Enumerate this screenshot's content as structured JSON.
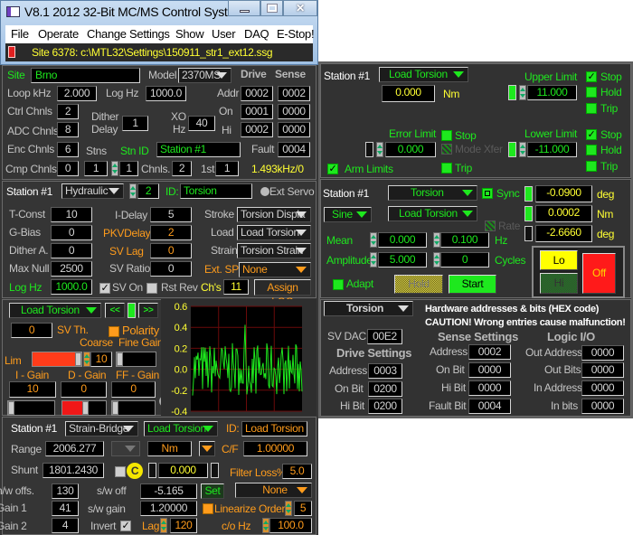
{
  "window": {
    "title": "V8.1 2012 32-Bit MC/MS Control System",
    "menu": [
      "File",
      "Operate",
      "Change Settings",
      "Show",
      "User",
      "DAQ",
      "E-Stop!"
    ],
    "status": "Site 6378: c:\\MTL32\\Settings\\150911_str1_ext12.ssg"
  },
  "config": {
    "site_label": "Site",
    "site": "Brno",
    "model_label": "Model",
    "model": "2370MS",
    "drive": "Drive",
    "sense": "Sense",
    "loop_label": "Loop kHz",
    "loop": "2.000",
    "loghz_label": "Log Hz",
    "loghz": "1000.0",
    "addr_label": "Addr",
    "drive_addr": "0002",
    "sense_addr": "0002",
    "ctrl_label": "Ctrl Chnls",
    "ctrl": "2",
    "on_label": "On",
    "drive_on": "0001",
    "sense_on": "0000",
    "adc_label": "ADC Chnls",
    "adc": "8",
    "dither1": "Dither",
    "dither2": "Delay",
    "dither": "1",
    "xo1": "XO",
    "xo2": "Hz",
    "xo": "40",
    "hi_label": "Hi",
    "drive_hi": "0002",
    "sense_hi": "0000",
    "enc_label": "Enc Chnls",
    "enc": "6",
    "stns_label": "Stns",
    "stnid_label": "Stn ID",
    "stnid": "Station #1",
    "fault_label": "Fault",
    "fault": "0004",
    "cmp_label": "Cmp Chnls",
    "cmp": "0",
    "stns": "1",
    "stn_sel": "1",
    "chnls_label": "Chnls.",
    "chnls": "2",
    "first_label": "1st",
    "first": "1",
    "rate": "1.493kHz/0"
  },
  "servo": {
    "station": "Station #1",
    "type": "Hydraulic",
    "num": "2",
    "id_label": "ID:",
    "id": "Torsion",
    "ext_servo": "Ext Servo",
    "tconst_label": "T-Const",
    "tconst": "10",
    "gbias_label": "G-Bias",
    "gbias": "0",
    "dither_label": "Dither A.",
    "dither": "0",
    "maxnull_label": "Max Null",
    "maxnull": "2500",
    "loghz_label": "Log Hz",
    "loghz": "1000.0",
    "idelay_label": "I-Delay",
    "idelay": "5",
    "pkv_label": "PKVDelay",
    "pkv": "2",
    "svlag_label": "SV Lag",
    "svlag": "0",
    "svratio_label": "SV Ratio",
    "svratio": "0",
    "stroke_label": "Stroke",
    "stroke": "Torsion Displa",
    "load_label": "Load",
    "load": "Load Torsion",
    "strain_label": "Strain",
    "strain": "Torsion Strain",
    "extsp_label": "Ext. SP",
    "extsp": "None",
    "svon": "SV On",
    "svon_checked": true,
    "rstrev": "Rst Rev",
    "rstrev_checked": false,
    "chs_label": "Ch's",
    "chs": "11",
    "assign": "Assign LOG"
  },
  "tuning": {
    "channel": "Load Torsion",
    "prev": "<<",
    "next": ">>",
    "svth": "0",
    "svth_label": "SV Th.",
    "polarity": "Polarity",
    "coarse_fine": "Coarse  Fine Gain",
    "lim": "Lim",
    "coarse": "10",
    "lim_level": 1.0,
    "igain_label": "I - Gain",
    "dgain_label": "D - Gain",
    "ffgain_label": "FF - Gain",
    "igain": "10",
    "dgain": "0",
    "ffgain": "0",
    "yticks": [
      "0.6",
      "0.4",
      "0.2",
      "0.0",
      "-0.2",
      "-0.4"
    ],
    "ylim": [
      -0.4,
      0.6
    ],
    "trace_color": "#1ee81e"
  },
  "sensor": {
    "station": "Station #1",
    "type": "Strain-Bridge",
    "channel": "Load Torsion",
    "id_label": "ID:",
    "id": "Load Torsion",
    "range_label": "Range",
    "range": "2006.277",
    "unit": "Nm",
    "cf_label": "C/F",
    "cf": "1.00000",
    "shunt_label": "Shunt",
    "shunt": "1801.2430",
    "cal": "C",
    "shunt_val": "0.000",
    "filter_label": "Filter Loss%",
    "filter": "5.0",
    "hwoff_label": "h/w offs.",
    "hwoff": "130",
    "swoff_label": "s/w off",
    "swoff": "-5.165",
    "set": "Set",
    "lin_sel": "None",
    "gain1_label": "Gain 1",
    "gain1": "41",
    "swgain_label": "s/w gain",
    "swgain": "1.20000",
    "lin_label": "Linearize Order",
    "lin": "5",
    "gain2_label": "Gain 2",
    "gain2": "4",
    "invert": "Invert",
    "invert_checked": true,
    "lag_label": "Lag",
    "lag": "120",
    "co_label": "c/o Hz",
    "co": "100.0"
  },
  "limits": {
    "station": "Station #1",
    "channel": "Load Torsion",
    "value": "0.000",
    "unit": "Nm",
    "upper_label": "Upper Limit",
    "upper": "11.000",
    "lower_label": "Lower Limit",
    "lower": "-11.000",
    "error_label": "Error Limit",
    "error": "0.000",
    "stop": "Stop",
    "hold": "Hold",
    "trip": "Trip",
    "modexfer": "Mode Xfer",
    "arm": "Arm Limits"
  },
  "generator": {
    "station": "Station #1",
    "channel": "Torsion",
    "sync": "Sync",
    "wave": "Sine",
    "control": "Load Torsion",
    "rate": "Rate",
    "r1": "-0.0900",
    "u1": "deg",
    "r2": "0.0002",
    "u2": "Nm",
    "r3": "-2.6660",
    "u3": "deg",
    "mean_label": "Mean",
    "mean": "0.000",
    "freq": "0.100",
    "hz": "Hz",
    "amp_label": "Amplitude",
    "amp": "5.000",
    "cycles": "0",
    "cycles_label": "Cycles",
    "adapt": "Adapt",
    "hold": "Hold",
    "start": "Start",
    "lo": "Lo",
    "hi": "Hi",
    "off": "Off"
  },
  "hardware": {
    "channel": "Torsion",
    "note1": "Hardware addresses & bits (HEX code)",
    "note2": "CAUTION! Wrong entries cause malfunction!",
    "svdac_label": "SV DAC",
    "svdac": "00E2",
    "drive_title": "Drive Settings",
    "sense_title": "Sense Settings",
    "logic_title": "Logic I/O",
    "d_addr_label": "Address",
    "d_addr": "0003",
    "d_on_label": "On Bit",
    "d_on": "0200",
    "d_hi_label": "Hi Bit",
    "d_hi": "0200",
    "s_addr_label": "Address",
    "s_addr": "0002",
    "s_on_label": "On Bit",
    "s_on": "0000",
    "s_hi_label": "Hi Bit",
    "s_hi": "0000",
    "s_fault_label": "Fault Bit",
    "s_fault": "0004",
    "out_addr_label": "Out Address",
    "out_addr": "0000",
    "out_bits_label": "Out Bits",
    "out_bits": "0000",
    "in_addr_label": "In Address",
    "in_addr": "0000",
    "in_bits_label": "In bits",
    "in_bits": "0000"
  }
}
